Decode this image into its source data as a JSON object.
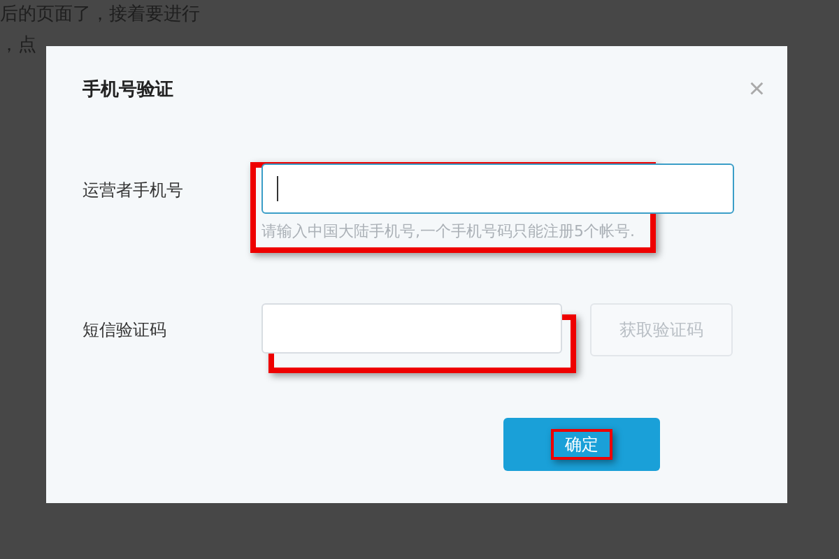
{
  "background_text": [
    "后的页面了，接着要进行",
    "，点"
  ],
  "dialog": {
    "title": "手机号验证",
    "close": "×",
    "fields": [
      {
        "kind": "input",
        "label": "运营者手机号",
        "focused": true,
        "hint": "请输入中国大陆手机号,一个手机号码只能注册5个帐号.",
        "highlighted": true
      },
      {
        "kind": "code",
        "label": "短信验证码",
        "focused": false,
        "button": {
          "label": "获取验证码",
          "disabled": true
        },
        "highlighted": true
      }
    ],
    "confirm": {
      "label": "确定",
      "highlighted": true
    }
  }
}
